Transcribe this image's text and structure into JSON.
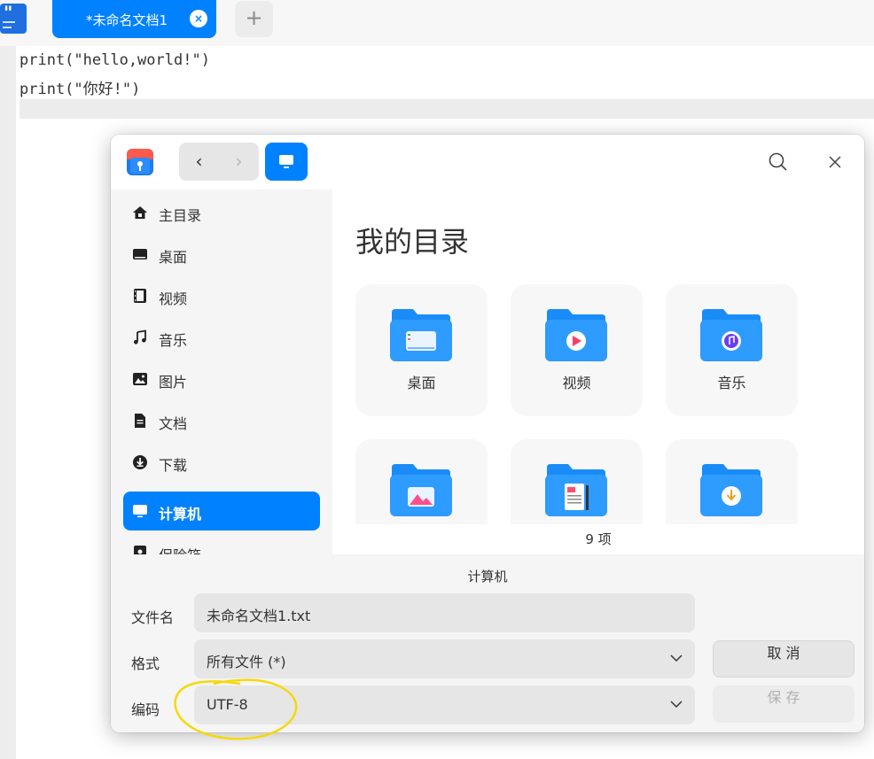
{
  "editor": {
    "tab_label": "*未命名文档1",
    "tab_close": "×",
    "add_tab": "+",
    "lines": [
      "print(\"hello,world!\")",
      "print(\"你好!\")"
    ]
  },
  "dialog": {
    "nav_back": "‹",
    "nav_forward": "›",
    "sidebar": [
      {
        "label": "主目录",
        "icon": "home-icon"
      },
      {
        "label": "桌面",
        "icon": "desktop-icon"
      },
      {
        "label": "视频",
        "icon": "video-icon"
      },
      {
        "label": "音乐",
        "icon": "music-icon"
      },
      {
        "label": "图片",
        "icon": "picture-icon"
      },
      {
        "label": "文档",
        "icon": "document-icon"
      },
      {
        "label": "下载",
        "icon": "download-icon"
      },
      {
        "label": "计算机",
        "icon": "computer-icon",
        "active": true
      },
      {
        "label": "保险箱",
        "icon": "safe-icon"
      }
    ],
    "main_title": "我的目录",
    "tiles": [
      {
        "label": "桌面",
        "icon": "desktop-folder-icon"
      },
      {
        "label": "视频",
        "icon": "video-folder-icon"
      },
      {
        "label": "音乐",
        "icon": "music-folder-icon"
      },
      {
        "label": "",
        "icon": "pictures-folder-icon"
      },
      {
        "label": "",
        "icon": "documents-folder-icon"
      },
      {
        "label": "",
        "icon": "downloads-folder-icon"
      }
    ],
    "item_count": "9 项",
    "current_dir": "计算机",
    "filename_label": "文件名",
    "filename_value": "未命名文档1.txt",
    "format_label": "格式",
    "format_value": "所有文件 (*)",
    "encoding_label": "编码",
    "encoding_value": "UTF-8",
    "cancel_label": "取 消",
    "save_label": "保 存"
  },
  "colors": {
    "accent": "#0081ff",
    "highlight": "#f5d90a"
  }
}
